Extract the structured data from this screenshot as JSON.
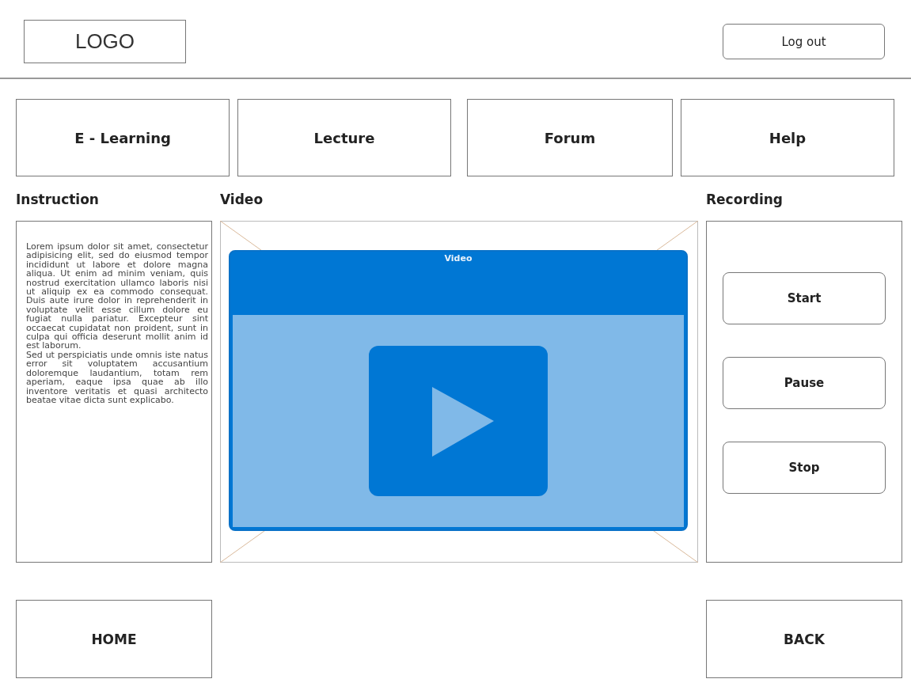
{
  "header": {
    "logo": "LOGO",
    "logout": "Log out"
  },
  "nav": [
    "E - Learning",
    "Lecture",
    "Forum",
    "Help"
  ],
  "instruction": {
    "heading": "Instruction",
    "paragraphs": [
      "Lorem ipsum dolor sit amet, consectetur adipisicing elit, sed do eiusmod tempor incididunt ut labore et dolore magna aliqua. Ut enim ad minim veniam, quis nostrud exercitation ullamco laboris nisi ut aliquip ex ea commodo consequat. Duis aute irure dolor in reprehenderit in voluptate velit esse cillum dolore eu fugiat nulla pariatur. Excepteur sint occaecat cupidatat non proident, sunt in culpa qui officia deserunt mollit anim id est laborum.",
      "Sed ut perspiciatis unde omnis iste natus error sit voluptatem accusantium doloremque laudantium, totam rem aperiam, eaque ipsa quae ab illo inventore veritatis et quasi architecto beatae vitae dicta sunt explicabo."
    ]
  },
  "video": {
    "heading": "Video",
    "player_title": "Video"
  },
  "recording": {
    "heading": "Recording",
    "buttons": [
      "Start",
      "Pause",
      "Stop"
    ]
  },
  "footer": {
    "home": "HOME",
    "back": "BACK"
  }
}
